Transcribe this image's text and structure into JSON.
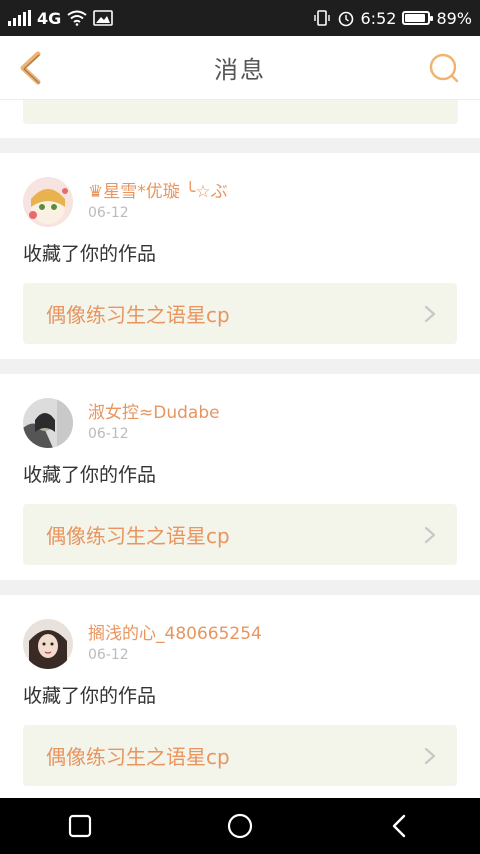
{
  "status_bar": {
    "network": "4G",
    "time": "6:52",
    "battery_percent": "89%",
    "battery_level": 0.89
  },
  "header": {
    "title": "消息",
    "accent_color": "#f2b26d"
  },
  "messages": [
    {
      "user_name": "♛星雪*优璇 ╰☆ぶ",
      "date": "06-12",
      "action": "收藏了你的作品",
      "work_title": "偶像练习生之语星cp"
    },
    {
      "user_name": "淑女控≈Dudabe",
      "date": "06-12",
      "action": "收藏了你的作品",
      "work_title": "偶像练习生之语星cp"
    },
    {
      "user_name": "搁浅的心_480665254",
      "date": "06-12",
      "action": "收藏了你的作品",
      "work_title": "偶像练习生之语星cp"
    }
  ],
  "icons": {
    "back": "chevron-left-icon",
    "search": "search-icon",
    "recent_apps": "square-icon",
    "home": "circle-icon",
    "nav_back": "triangle-back-icon"
  }
}
